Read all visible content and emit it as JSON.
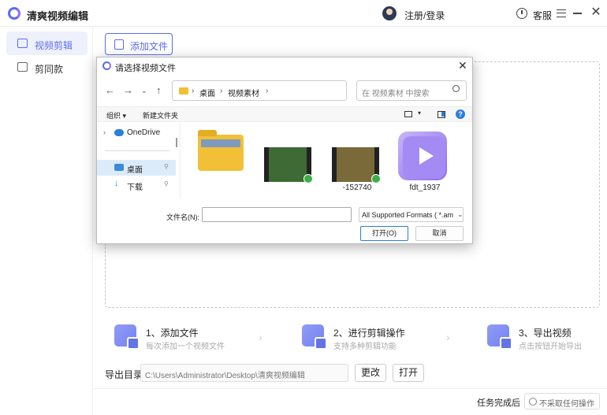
{
  "app": {
    "title": "清爽视频编辑",
    "login": "注册/登录",
    "support": "客服"
  },
  "sidebar": {
    "items": [
      {
        "label": "视频剪辑",
        "active": true
      },
      {
        "label": "剪同款",
        "active": false
      }
    ]
  },
  "main": {
    "add_file_label": "添加文件",
    "steps": [
      {
        "title": "1、添加文件",
        "subtitle": "每次添加一个视频文件"
      },
      {
        "title": "2、进行剪辑操作",
        "subtitle": "支持多种剪辑功能"
      },
      {
        "title": "3、导出视频",
        "subtitle": "点击按钮开始导出"
      }
    ],
    "output": {
      "label": "导出目录",
      "path": "C:\\Users\\Administrator\\Desktop\\清爽视频编辑",
      "change_label": "更改",
      "open_label": "打开"
    },
    "bottom": {
      "on_complete_label": "任务完成后",
      "on_complete_value": "不采取任何操作"
    }
  },
  "dialog": {
    "title": "请选择视频文件",
    "breadcrumbs": [
      "桌面",
      "视频素材"
    ],
    "search_placeholder": "在 视频素材 中搜索",
    "organize_label": "组织 ▾",
    "new_folder_label": "新建文件夹",
    "nav_items": [
      {
        "label": "OneDrive",
        "icon": "cloud-icon",
        "selected": false
      },
      {
        "label": "桌面",
        "icon": "desktop-icon",
        "selected": true
      },
      {
        "label": "下载",
        "icon": "download-icon",
        "selected": false
      }
    ],
    "files": [
      {
        "name": "",
        "kind": "folder"
      },
      {
        "name": "",
        "kind": "video"
      },
      {
        "name": "-152740",
        "kind": "video"
      },
      {
        "name": "fdt_1937",
        "kind": "app-video"
      }
    ],
    "filename_label": "文件名(N):",
    "filename_value": "",
    "filetype_value": "All Supported Formats ( *.am",
    "open_label": "打开(O)",
    "cancel_label": "取消"
  },
  "colors": {
    "accent": "#5a6cf0",
    "folder": "#f2c037",
    "selection": "#dcebf9"
  }
}
